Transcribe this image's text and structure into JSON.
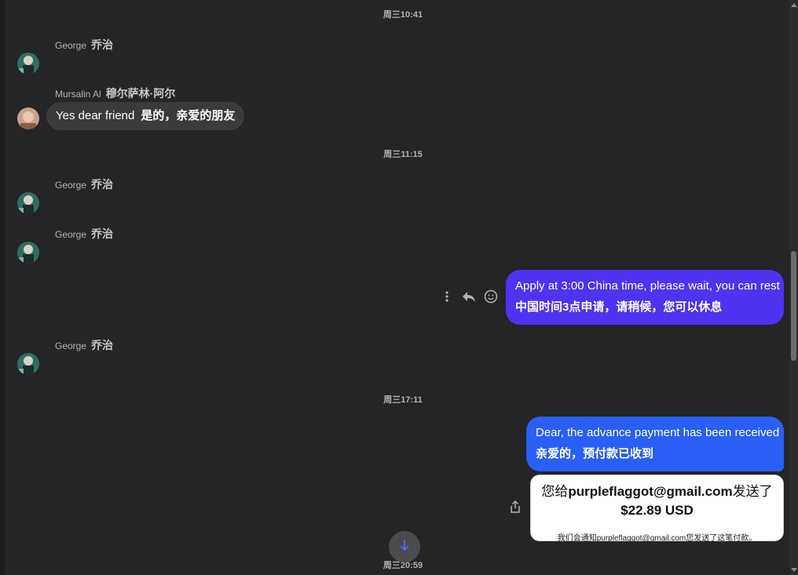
{
  "timestamps": [
    "周三10:41",
    "周三11:15",
    "周三17:11",
    "周三20:59"
  ],
  "messages": {
    "george1": {
      "name": "George",
      "name_tr": "乔治"
    },
    "mursalin": {
      "name": "Mursalin Al",
      "name_tr": "穆尔萨林·阿尔",
      "text": "Yes dear friend",
      "text_tr": "是的，亲爱的朋友"
    },
    "george2": {
      "name": "George",
      "name_tr": "乔治"
    },
    "george3": {
      "name": "George",
      "name_tr": "乔治"
    },
    "me1": {
      "text": "Apply at 3:00 China time, please wait, you can rest",
      "text_tr": "中国时间3点申请，请稍候，您可以休息"
    },
    "george4": {
      "name": "George",
      "name_tr": "乔治"
    },
    "me2": {
      "text": "Dear, the advance payment has been received",
      "text_tr": "亲爱的，预付款已收到"
    }
  },
  "payment_card": {
    "prefix": "您给",
    "email": "purpleflaggot@gmail.com",
    "suffix": "发送了",
    "amount": "$22.89 USD",
    "note": "我们会通知purpleflaggot@gmail.com您发送了这笔付款。"
  },
  "icons": {
    "more": "more-vertical-icon",
    "reply": "reply-icon",
    "react": "smiley-icon",
    "share": "share-icon",
    "scroll": "arrow-down-icon"
  },
  "colors": {
    "background": "#242526",
    "outgoing_purple": "#4e33f0",
    "outgoing_blue": "#2a5ff5",
    "incoming": "#3a3b3c"
  }
}
